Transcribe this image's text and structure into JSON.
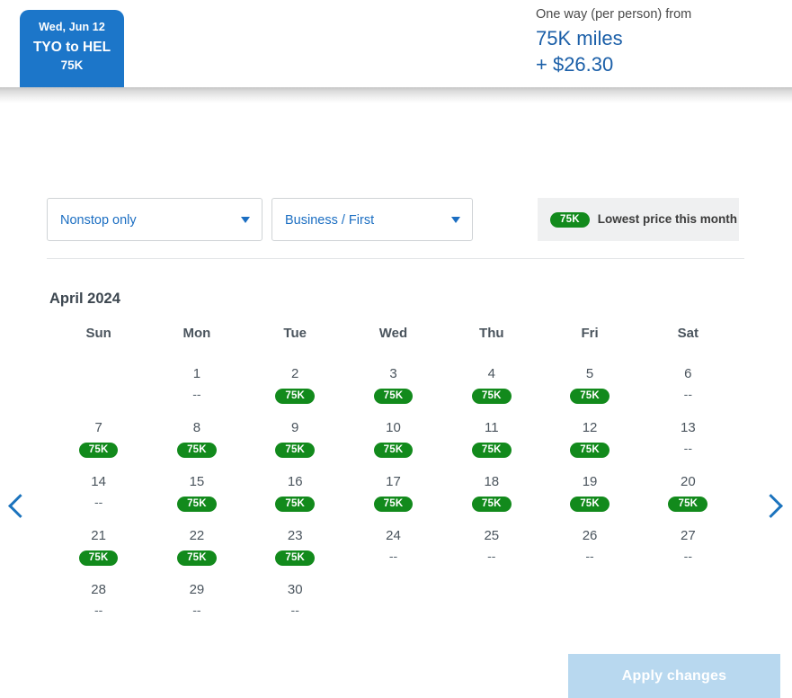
{
  "header": {
    "flight_tab": {
      "date": "Wed, Jun 12",
      "route": "TYO to HEL",
      "miles": "75K"
    },
    "price": {
      "label": "One way (per person) from",
      "miles": "75K miles",
      "cash": "+ $26.30"
    }
  },
  "filters": {
    "stops": {
      "value": "Nonstop only",
      "caret_icon": "chevron-down-icon"
    },
    "cabin": {
      "value": "Business / First",
      "caret_icon": "chevron-down-icon"
    },
    "legend": {
      "badge": "75K",
      "text": "Lowest price this month"
    }
  },
  "calendar": {
    "month_title": "April 2024",
    "weekdays": [
      "Sun",
      "Mon",
      "Tue",
      "Wed",
      "Thu",
      "Fri",
      "Sat"
    ],
    "prev_icon": "chevron-left-icon",
    "next_icon": "chevron-right-icon",
    "no_price_marker": "--",
    "lowest_badge_color": "#128a1c",
    "weeks": [
      [
        {
          "day": "",
          "value": "",
          "type": "empty"
        },
        {
          "day": "1",
          "value": "--",
          "type": "none"
        },
        {
          "day": "2",
          "value": "75K",
          "type": "lowest"
        },
        {
          "day": "3",
          "value": "75K",
          "type": "lowest"
        },
        {
          "day": "4",
          "value": "75K",
          "type": "lowest"
        },
        {
          "day": "5",
          "value": "75K",
          "type": "lowest"
        },
        {
          "day": "6",
          "value": "--",
          "type": "none"
        }
      ],
      [
        {
          "day": "7",
          "value": "75K",
          "type": "lowest"
        },
        {
          "day": "8",
          "value": "75K",
          "type": "lowest"
        },
        {
          "day": "9",
          "value": "75K",
          "type": "lowest"
        },
        {
          "day": "10",
          "value": "75K",
          "type": "lowest"
        },
        {
          "day": "11",
          "value": "75K",
          "type": "lowest"
        },
        {
          "day": "12",
          "value": "75K",
          "type": "lowest"
        },
        {
          "day": "13",
          "value": "--",
          "type": "none"
        }
      ],
      [
        {
          "day": "14",
          "value": "--",
          "type": "none"
        },
        {
          "day": "15",
          "value": "75K",
          "type": "lowest"
        },
        {
          "day": "16",
          "value": "75K",
          "type": "lowest"
        },
        {
          "day": "17",
          "value": "75K",
          "type": "lowest"
        },
        {
          "day": "18",
          "value": "75K",
          "type": "lowest"
        },
        {
          "day": "19",
          "value": "75K",
          "type": "lowest"
        },
        {
          "day": "20",
          "value": "75K",
          "type": "lowest"
        }
      ],
      [
        {
          "day": "21",
          "value": "75K",
          "type": "lowest"
        },
        {
          "day": "22",
          "value": "75K",
          "type": "lowest"
        },
        {
          "day": "23",
          "value": "75K",
          "type": "lowest"
        },
        {
          "day": "24",
          "value": "--",
          "type": "none"
        },
        {
          "day": "25",
          "value": "--",
          "type": "none"
        },
        {
          "day": "26",
          "value": "--",
          "type": "none"
        },
        {
          "day": "27",
          "value": "--",
          "type": "none"
        }
      ],
      [
        {
          "day": "28",
          "value": "--",
          "type": "none"
        },
        {
          "day": "29",
          "value": "--",
          "type": "none"
        },
        {
          "day": "30",
          "value": "--",
          "type": "none"
        },
        {
          "day": "",
          "value": "",
          "type": "empty"
        },
        {
          "day": "",
          "value": "",
          "type": "empty"
        },
        {
          "day": "",
          "value": "",
          "type": "empty"
        },
        {
          "day": "",
          "value": "",
          "type": "empty"
        }
      ]
    ]
  },
  "footer": {
    "apply_label": "Apply changes"
  }
}
